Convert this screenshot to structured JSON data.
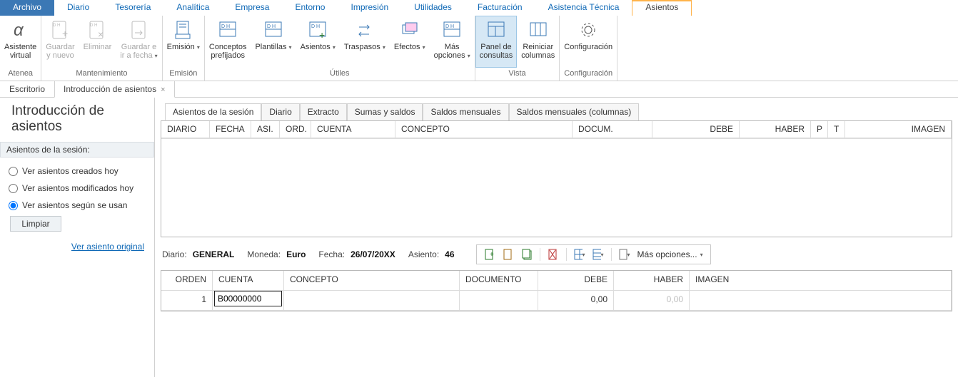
{
  "menu": {
    "items": [
      "Archivo",
      "Diario",
      "Tesorería",
      "Analítica",
      "Empresa",
      "Entorno",
      "Impresión",
      "Utilidades",
      "Facturación",
      "Asistencia Técnica",
      "Asientos"
    ],
    "active_index": 10
  },
  "ribbon": {
    "groups": [
      {
        "caption": "Atenea",
        "buttons": [
          {
            "label": "Asistente\nvirtual",
            "name": "asistente-virtual-button",
            "icon": "alpha"
          }
        ]
      },
      {
        "caption": "Mantenimiento",
        "buttons": [
          {
            "label": "Guardar\ny nuevo",
            "name": "guardar-y-nuevo-button",
            "icon": "doc-plus",
            "disabled": true
          },
          {
            "label": "Eliminar",
            "name": "eliminar-button",
            "icon": "doc-x",
            "disabled": true
          },
          {
            "label": "Guardar e\nir a fecha",
            "name": "guardar-ir-fecha-button",
            "icon": "doc-arrow",
            "disabled": true,
            "dropdown": true
          }
        ]
      },
      {
        "caption": "Emisión",
        "buttons": [
          {
            "label": "Emisión",
            "name": "emision-button",
            "icon": "doc-print",
            "dropdown": true
          }
        ]
      },
      {
        "caption": "Útiles",
        "buttons": [
          {
            "label": "Conceptos\nprefijados",
            "name": "conceptos-prefijados-button",
            "icon": "dh"
          },
          {
            "label": "Plantillas",
            "name": "plantillas-button",
            "icon": "dh",
            "dropdown": true
          },
          {
            "label": "Asientos",
            "name": "asientos-button",
            "icon": "dh-plus",
            "dropdown": true
          },
          {
            "label": "Traspasos",
            "name": "traspasos-button",
            "icon": "swap",
            "dropdown": true
          },
          {
            "label": "Efectos",
            "name": "efectos-button",
            "icon": "cards",
            "dropdown": true
          },
          {
            "label": "Más\nopciones",
            "name": "mas-opciones-button",
            "icon": "dh",
            "dropdown": true
          }
        ]
      },
      {
        "caption": "Vista",
        "buttons": [
          {
            "label": "Panel de\nconsultas",
            "name": "panel-consultas-button",
            "icon": "panel",
            "active": true
          },
          {
            "label": "Reiniciar\ncolumnas",
            "name": "reiniciar-columnas-button",
            "icon": "columns"
          }
        ]
      },
      {
        "caption": "Configuración",
        "buttons": [
          {
            "label": "Configuración",
            "name": "configuracion-button",
            "icon": "gear"
          }
        ]
      }
    ]
  },
  "doctabs": {
    "items": [
      "Escritorio",
      "Introducción de asientos"
    ],
    "active_index": 1
  },
  "page_title": "Introducción de asientos",
  "session_panel": {
    "header": "Asientos de la sesión:",
    "radios": [
      {
        "label": "Ver asientos creados hoy",
        "checked": false
      },
      {
        "label": "Ver asientos modificados hoy",
        "checked": false
      },
      {
        "label": "Ver asientos según se usan",
        "checked": true
      }
    ],
    "clear_btn": "Limpiar",
    "link": "Ver asiento original"
  },
  "inner_tabs": {
    "items": [
      "Asientos de la sesión",
      "Diario",
      "Extracto",
      "Sumas y saldos",
      "Saldos mensuales",
      "Saldos mensuales (columnas)"
    ],
    "active_index": 0
  },
  "top_grid": {
    "headers": [
      "DIARIO",
      "FECHA",
      "ASI.",
      "ORD.",
      "CUENTA",
      "CONCEPTO",
      "DOCUM.",
      "DEBE",
      "HABER",
      "P",
      "T",
      "IMAGEN"
    ]
  },
  "info": {
    "diario_k": "Diario:",
    "diario_v": "GENERAL",
    "moneda_k": "Moneda:",
    "moneda_v": "Euro",
    "fecha_k": "Fecha:",
    "fecha_v": "26/07/20XX",
    "asiento_k": "Asiento:",
    "asiento_v": "46",
    "more_opts": "Más opciones..."
  },
  "bot_grid": {
    "headers": [
      "ORDEN",
      "CUENTA",
      "CONCEPTO",
      "DOCUMENTO",
      "DEBE",
      "HABER",
      "IMAGEN"
    ],
    "row": {
      "orden": "1",
      "cuenta": "B00000000",
      "concepto": "",
      "documento": "",
      "debe": "0,00",
      "haber": "0,00",
      "imagen": ""
    }
  }
}
